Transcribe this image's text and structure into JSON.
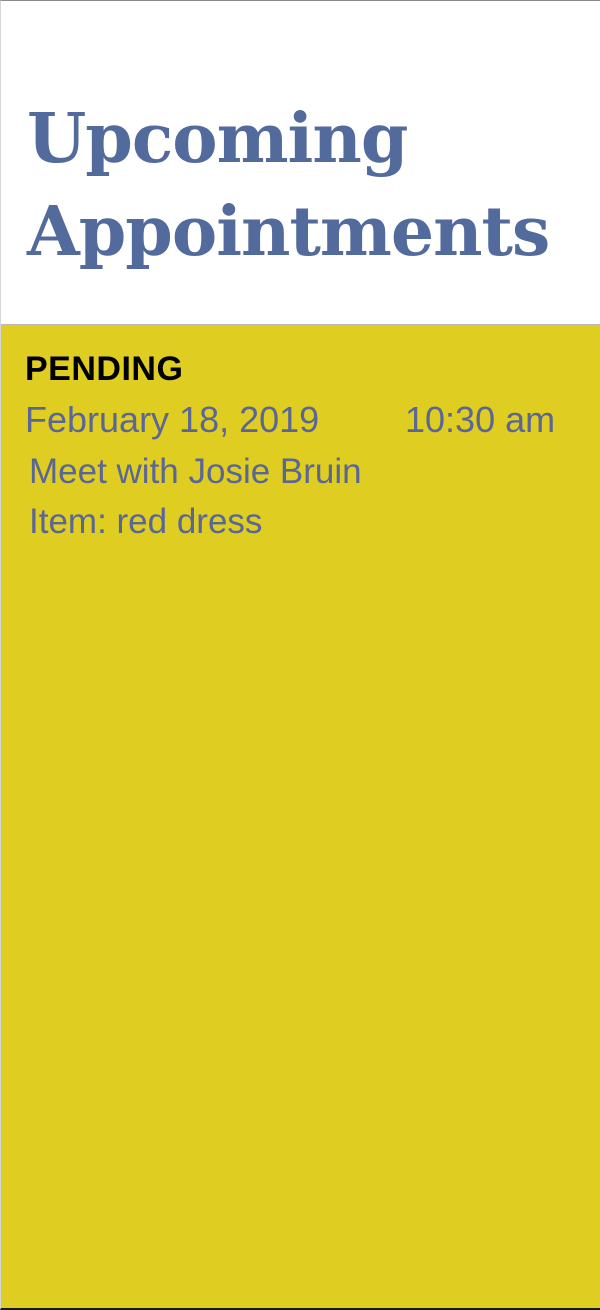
{
  "header": {
    "title_line1": "Upcoming",
    "title_line2": "Appointments"
  },
  "appointment": {
    "status": "PENDING",
    "date": "February 18, 2019",
    "time": "10:30 am",
    "description": "Meet with Josie Bruin",
    "item": "Item: red dress"
  },
  "colors": {
    "title": "#536a9c",
    "panel_background": "#dfcd22",
    "detail_text": "#5a6796",
    "status_text": "#000000"
  }
}
